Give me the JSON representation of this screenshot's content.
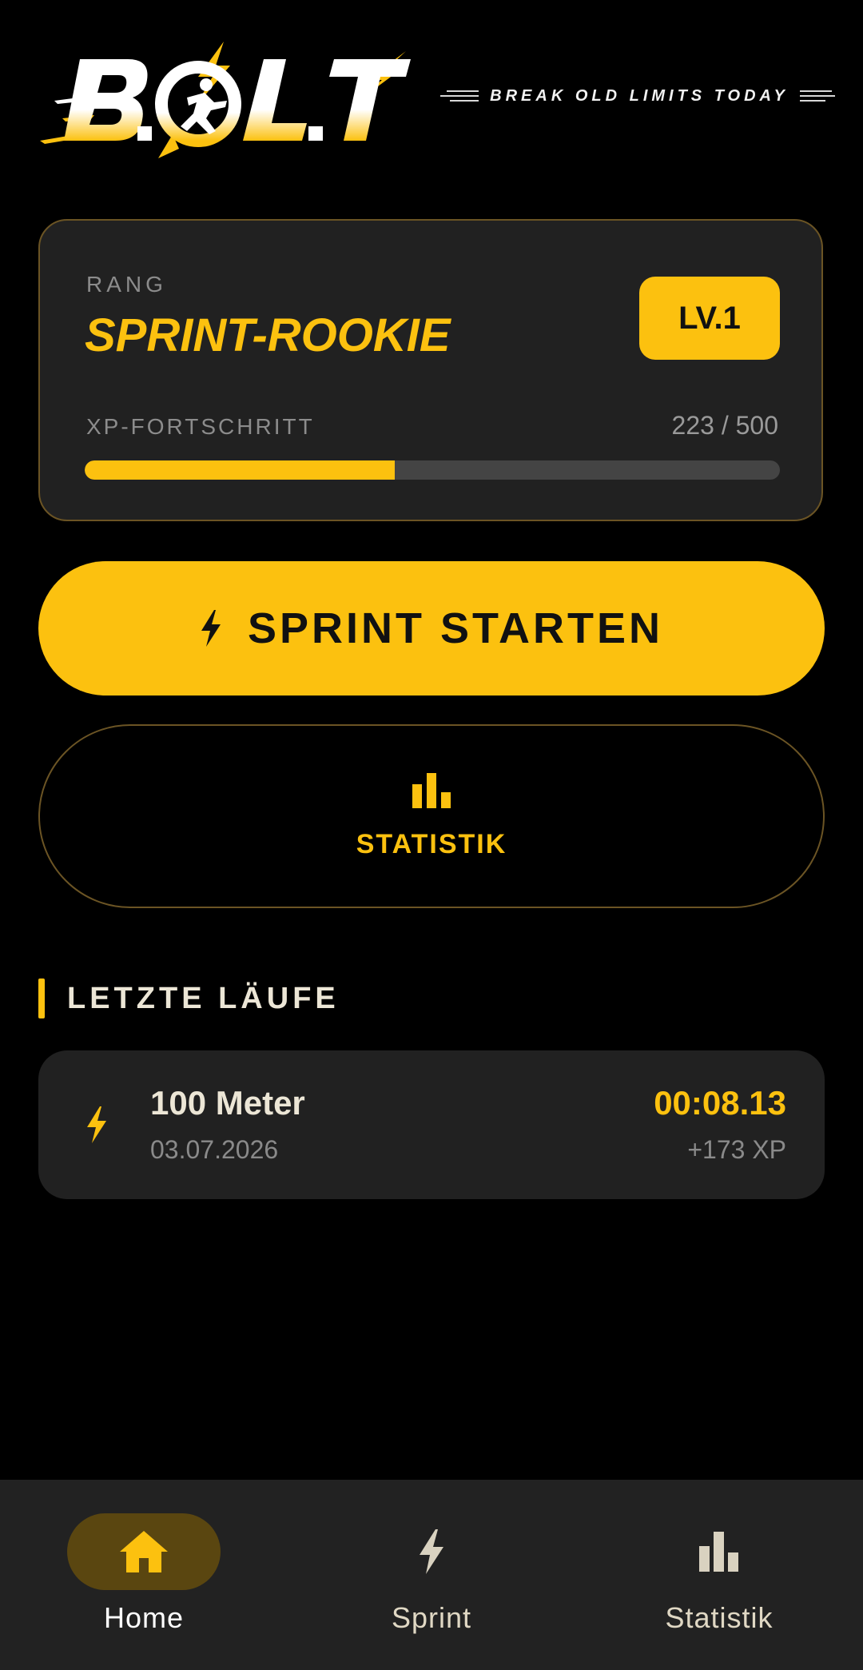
{
  "brand": {
    "logo_text": "B.O.L.T",
    "tagline": "BREAK OLD LIMITS TODAY"
  },
  "rank_card": {
    "rank_label": "RANG",
    "rank_name": "SPRINT-ROOKIE",
    "level_badge": "LV.1",
    "xp_label": "XP-FORTSCHRITT",
    "xp_text": "223 / 500",
    "xp_current": 223,
    "xp_max": 500
  },
  "actions": {
    "sprint_label": "SPRINT STARTEN",
    "stats_label": "STATISTIK"
  },
  "recent": {
    "title": "LETZTE LÄUFE",
    "runs": [
      {
        "distance": "100 Meter",
        "date": "03.07.2026",
        "time": "00:08.13",
        "xp": "+173 XP"
      }
    ]
  },
  "bottom_nav": {
    "items": [
      {
        "label": "Home",
        "icon": "home-icon",
        "active": true
      },
      {
        "label": "Sprint",
        "icon": "bolt-icon",
        "active": false
      },
      {
        "label": "Statistik",
        "icon": "bar-chart-icon",
        "active": false
      }
    ]
  },
  "colors": {
    "accent": "#fcc10f",
    "background": "#000000",
    "card": "#212121",
    "card_border": "#6b5424",
    "muted_text": "#8c8c8c",
    "nav_active_pill": "#5a4610"
  }
}
